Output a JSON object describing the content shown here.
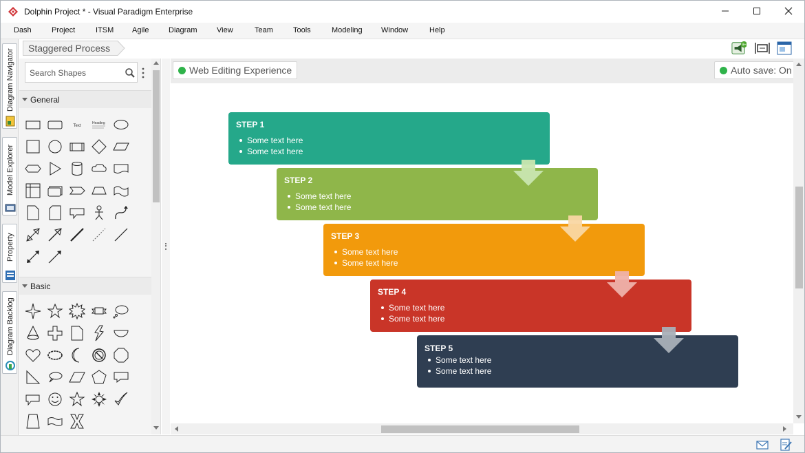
{
  "window": {
    "title": "Dolphin Project * - Visual Paradigm Enterprise",
    "app_icon": "visual-paradigm-logo-icon",
    "controls": [
      "minimize-icon",
      "maximize-icon",
      "close-icon"
    ]
  },
  "menu": [
    "Dash",
    "Project",
    "ITSM",
    "Agile",
    "Diagram",
    "View",
    "Team",
    "Tools",
    "Modeling",
    "Window",
    "Help"
  ],
  "side_tabs": [
    {
      "label": "Diagram Navigator",
      "icon": "diagram-navigator-icon"
    },
    {
      "label": "Model Explorer",
      "icon": "model-explorer-icon"
    },
    {
      "label": "Property",
      "icon": "property-icon"
    },
    {
      "label": "Diagram Backlog",
      "icon": "diagram-backlog-icon"
    }
  ],
  "breadcrumb": {
    "label": "Staggered Process"
  },
  "shape_panel": {
    "search_placeholder": "Search Shapes",
    "categories": [
      {
        "name": "General"
      },
      {
        "name": "Basic"
      }
    ],
    "general_text_label": "Text",
    "general_heading_label": "Heading"
  },
  "toolbar_right": {
    "notification_badge": "9+",
    "icons": [
      "announcement-icon",
      "fit-diagram-icon",
      "diagram-overview-icon"
    ]
  },
  "canvas": {
    "web_editing_label": "Web Editing Experience",
    "autosave_label": "Auto save: On",
    "status_color": "#2fb34a"
  },
  "steps": [
    {
      "title": "STEP 1",
      "bullets": [
        "Some text here",
        "Some text here"
      ],
      "color": "#25a88a",
      "arrow_color": "#c9e6b0"
    },
    {
      "title": "STEP 2",
      "bullets": [
        "Some text here",
        "Some text here"
      ],
      "color": "#8fb64a",
      "arrow_color": "#f9d7a3"
    },
    {
      "title": "STEP 3",
      "bullets": [
        "Some text here",
        "Some text here"
      ],
      "color": "#f29a0c",
      "arrow_color": "#efb2aa"
    },
    {
      "title": "STEP 4",
      "bullets": [
        "Some text here",
        "Some text here"
      ],
      "color": "#c93528",
      "arrow_color": "#a9b0b8"
    },
    {
      "title": "STEP 5",
      "bullets": [
        "Some text here",
        "Some text here"
      ],
      "color": "#2f3e52",
      "arrow_color": ""
    }
  ],
  "statusbar": {
    "icons": [
      "mail-icon",
      "edit-note-icon"
    ]
  }
}
